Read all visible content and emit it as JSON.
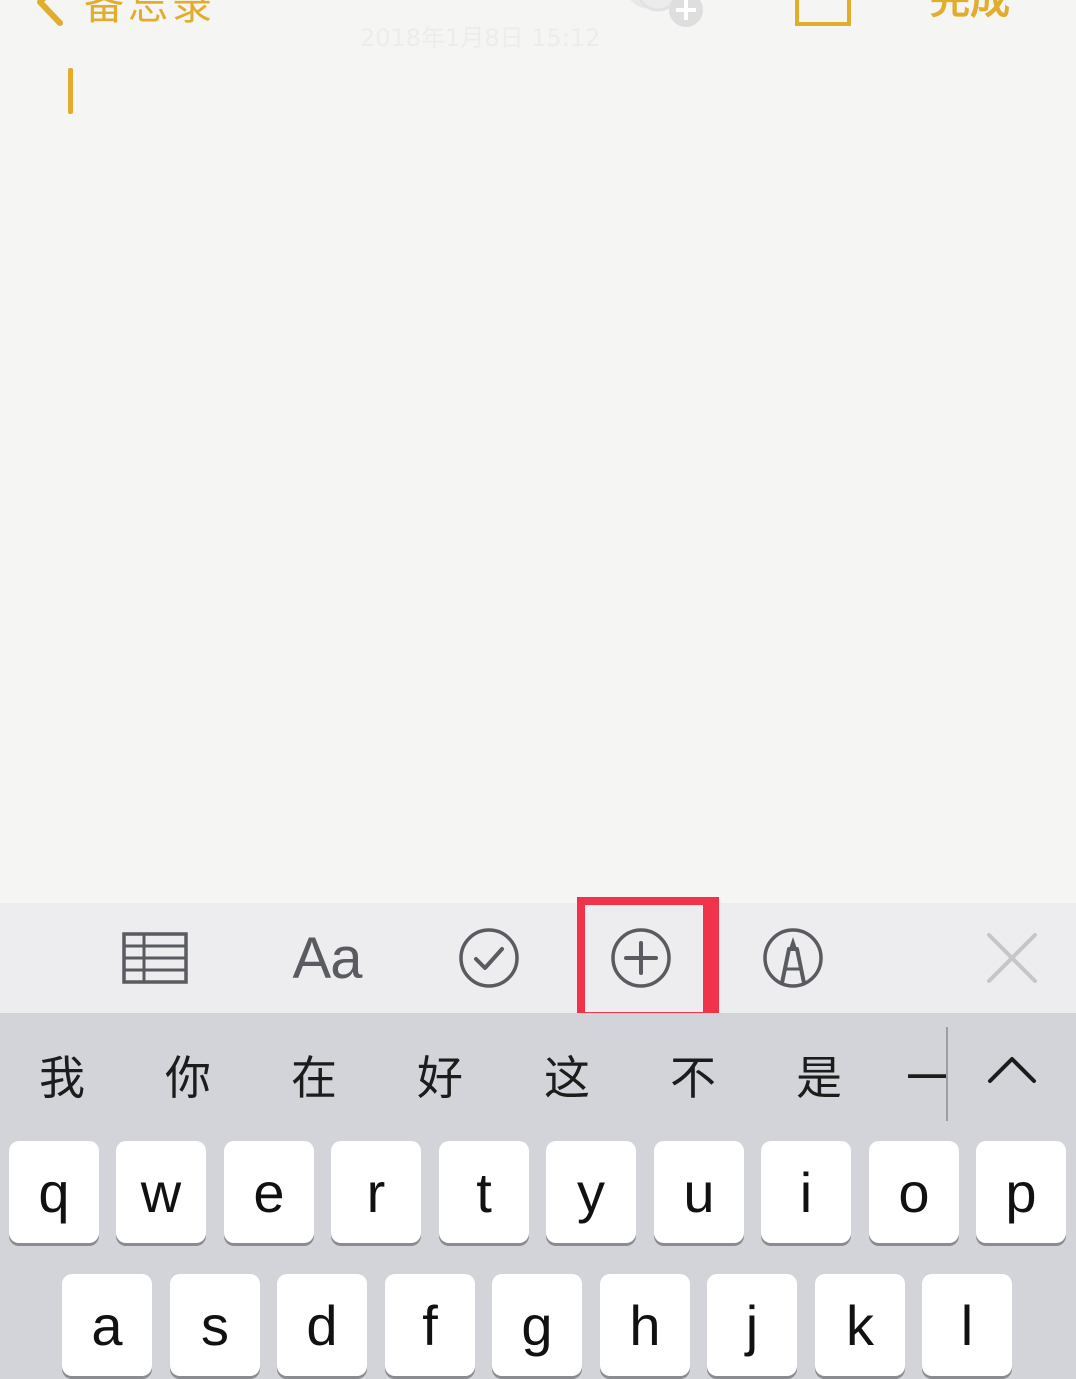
{
  "nav": {
    "back_label": "备忘录",
    "done_label": "完成",
    "date_text": "2018年1月8日 15:12"
  },
  "note": {
    "body": ""
  },
  "toolbar": {
    "table_icon": "table-icon",
    "format_label": "Aa",
    "checklist_icon": "checkmark-circle-icon",
    "add_icon": "plus-circle-icon",
    "markup_icon": "pen-circle-icon",
    "close_icon": "close-icon"
  },
  "candidates": [
    "我",
    "你",
    "在",
    "好",
    "这",
    "不",
    "是",
    "一"
  ],
  "keyboard": {
    "row1": [
      "q",
      "w",
      "e",
      "r",
      "t",
      "y",
      "u",
      "i",
      "o",
      "p"
    ],
    "row2": [
      "a",
      "s",
      "d",
      "f",
      "g",
      "h",
      "j",
      "k",
      "l"
    ]
  },
  "colors": {
    "accent": "#e2ad2c",
    "highlight": "#f0334b",
    "toolbar_icon": "#595b60",
    "keyboard_bg": "#d2d4da",
    "toolbar_bg": "#ededef"
  }
}
